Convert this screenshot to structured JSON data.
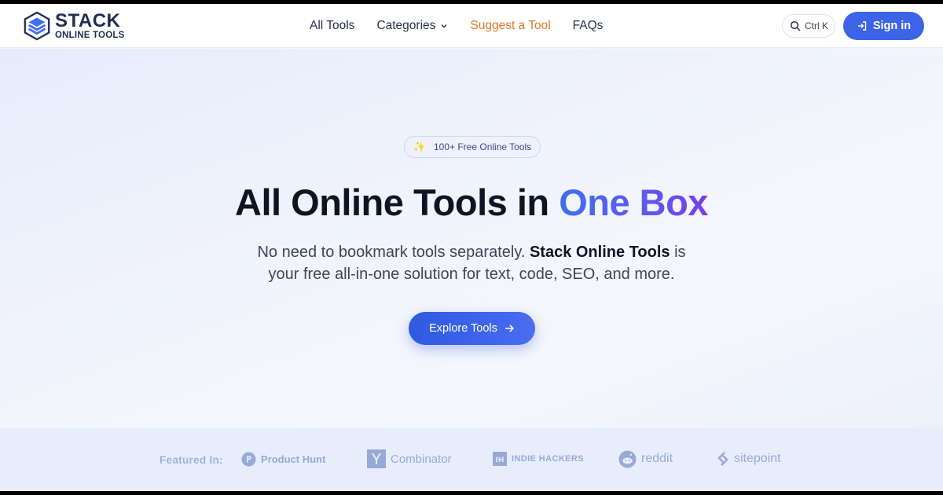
{
  "brand": {
    "name_line1": "STACK",
    "name_line2": "ONLINE TOOLS",
    "logo_icon": "stacked-layers-hexagon-icon",
    "color": "#1f2d52"
  },
  "nav": {
    "items": [
      {
        "label": "All Tools"
      },
      {
        "label": "Categories",
        "has_dropdown": true
      },
      {
        "label": "Suggest a Tool",
        "highlight": true
      },
      {
        "label": "FAQs"
      }
    ],
    "highlight_color": "#e07a2a"
  },
  "search": {
    "shortcut_label": "Ctrl K",
    "icon": "search-icon"
  },
  "signin": {
    "label": "Sign in",
    "icon": "login-icon",
    "color": "#3d63e6"
  },
  "hero": {
    "badge": "100+ Free Online Tools",
    "badge_icon": "sparkle-icon",
    "headline_plain": "All Online Tools in ",
    "headline_accent": "One Box",
    "sub_line1_pre": "No need to bookmark tools separately. ",
    "sub_line1_bold": "Stack Online Tools",
    "sub_line1_post": " is",
    "sub_line2": "your free all-in-one solution for text, code, SEO, and more.",
    "cta_label": "Explore Tools",
    "cta_icon": "arrow-right-icon",
    "accent_gradient": [
      "#3f6ff0",
      "#7b3fe6"
    ]
  },
  "featured": {
    "label": "Featured In:",
    "partners": [
      {
        "name": "Product Hunt",
        "icon": "product-hunt-icon"
      },
      {
        "name": "Combinator",
        "icon": "y-combinator-icon"
      },
      {
        "name": "INDIE HACKERS",
        "icon": "indie-hackers-icon"
      },
      {
        "name": "reddit",
        "icon": "reddit-icon"
      },
      {
        "name": "sitepoint",
        "icon": "sitepoint-icon"
      }
    ],
    "muted_color": "#97a9d6"
  }
}
